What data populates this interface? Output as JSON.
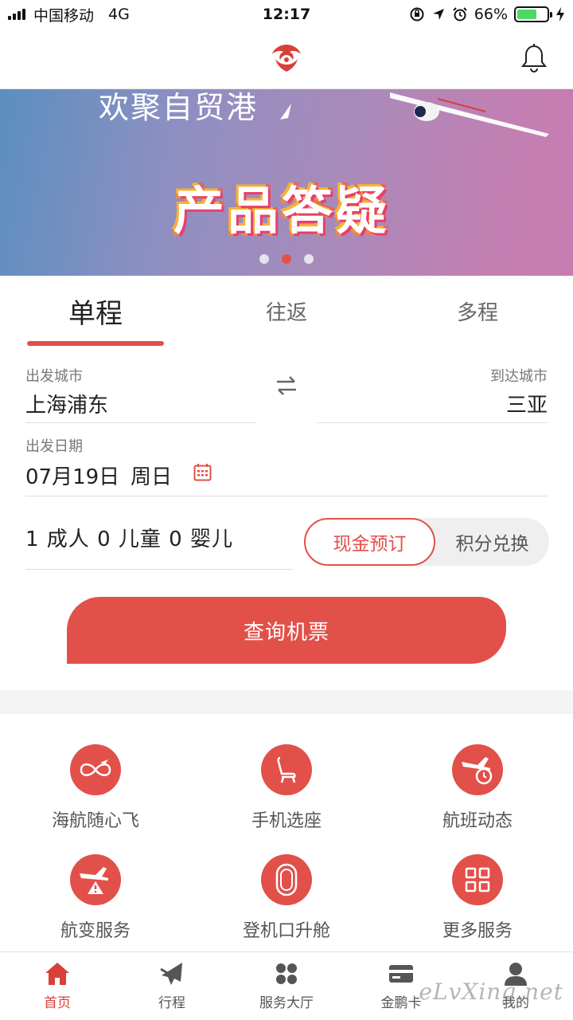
{
  "status_bar": {
    "carrier": "中国移动",
    "network": "4G",
    "time": "12:17",
    "battery": "66%",
    "battery_level": 0.66
  },
  "header": {
    "logo_icon": "airline-logo-icon",
    "bell_icon": "bell-icon"
  },
  "banner": {
    "subtitle": "欢聚自贸港",
    "title": "产品答疑",
    "dots_total": 3,
    "active_dot": 2
  },
  "trip_tabs": [
    {
      "label": "单程",
      "active": true
    },
    {
      "label": "往返",
      "active": false
    },
    {
      "label": "多程",
      "active": false
    }
  ],
  "search_form": {
    "departure_label": "出发城市",
    "departure_city": "上海浦东",
    "arrival_label": "到达城市",
    "arrival_city": "三亚",
    "date_label": "出发日期",
    "date_value": "07月19日",
    "weekday": "周日",
    "passengers": "1 成人 0 儿童 0 婴儿",
    "pay_cash": "现金预订",
    "pay_points": "积分兑换",
    "search_button": "查询机票"
  },
  "services": [
    {
      "label": "海航随心飞",
      "icon": "infinity-plane-icon"
    },
    {
      "label": "手机选座",
      "icon": "seat-icon"
    },
    {
      "label": "航班动态",
      "icon": "flight-clock-icon"
    },
    {
      "label": "航变服务",
      "icon": "flight-warning-icon"
    },
    {
      "label": "登机口升舱",
      "icon": "plane-window-icon"
    },
    {
      "label": "更多服务",
      "icon": "grid-icon"
    }
  ],
  "tabbar": [
    {
      "label": "首页",
      "icon": "home-icon",
      "active": true
    },
    {
      "label": "行程",
      "icon": "plane-icon",
      "active": false
    },
    {
      "label": "服务大厅",
      "icon": "dots-grid-icon",
      "active": false
    },
    {
      "label": "金鹏卡",
      "icon": "card-icon",
      "active": false
    },
    {
      "label": "我的",
      "icon": "user-icon",
      "active": false
    }
  ],
  "watermark": "eLvXing.net",
  "colors": {
    "accent": "#e2504a",
    "battery_green": "#4cd964"
  }
}
